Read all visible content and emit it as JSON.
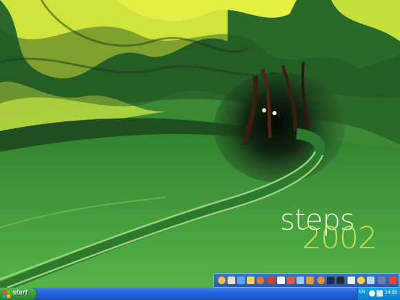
{
  "wallpaper": {
    "word_top": "steps",
    "word_bottom": "2002"
  },
  "quicklaunch": {
    "icons": [
      "globe-icon",
      "pencil-icon",
      "media-icon",
      "folder-icon",
      "firefox-icon",
      "app-icon",
      "notepad-icon",
      "paint-icon",
      "calculator-icon",
      "photo-icon",
      "chat-icon",
      "email-icon",
      "security-icon",
      "settings-icon",
      "emoticon-icon",
      "image-icon",
      "tool-icon",
      "shortcut-icon"
    ]
  },
  "taskbar": {
    "start_label": "start",
    "tray": {
      "language": "EN",
      "clock": "14:59"
    }
  },
  "colors": {
    "taskbar_blue": "#2361d8",
    "start_green": "#379a37",
    "tray_blue": "#0f8fdc",
    "accent_yellow_green": "#c6de57"
  }
}
